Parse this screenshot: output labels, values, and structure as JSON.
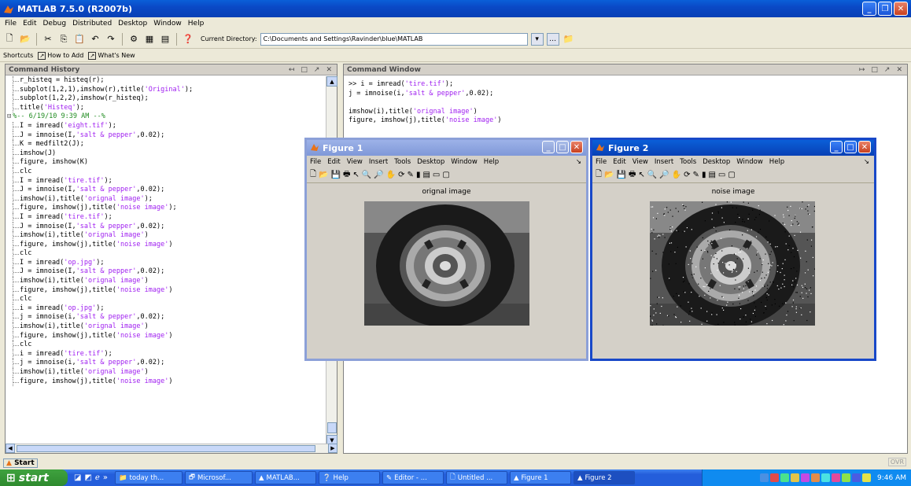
{
  "app": {
    "title": "MATLAB 7.5.0 (R2007b)",
    "menu": [
      "File",
      "Edit",
      "Debug",
      "Distributed",
      "Desktop",
      "Window",
      "Help"
    ]
  },
  "toolbar": {
    "current_directory_label": "Current Directory:",
    "current_directory_value": "C:\\Documents and Settings\\Ravinder\\blue\\MATLAB"
  },
  "shortcuts": {
    "label": "Shortcuts",
    "items": [
      "How to Add",
      "What's New"
    ]
  },
  "history": {
    "title": "Command History",
    "lines": [
      {
        "code": "r_histeq = histeq(r);"
      },
      {
        "code": "subplot(1,2,1),imshow(r),title(",
        "str": "'Original'",
        "tail": ");"
      },
      {
        "code": "subplot(1,2,2),imshow(r_histeq);"
      },
      {
        "code": "title(",
        "str": "'Histeq'",
        "tail": ");"
      },
      {
        "node": "%-- 6/19/10  9:39 AM --%"
      },
      {
        "code": "I = imread(",
        "str": "'eight.tif'",
        "tail": ");"
      },
      {
        "code": "J = imnoise(I,",
        "str": "'salt & pepper'",
        "tail": ",0.02);"
      },
      {
        "code": "K = medfilt2(J);"
      },
      {
        "code": "imshow(J)"
      },
      {
        "code": "figure, imshow(K)"
      },
      {
        "code": "clc"
      },
      {
        "code": "I = imread(",
        "str": "'tire.tif'",
        "tail": ");"
      },
      {
        "code": "J = imnoise(I,",
        "str": "'salt & pepper'",
        "tail": ",0.02);"
      },
      {
        "code": "imshow(i),title(",
        "str": "'orignal image'",
        "tail": ");"
      },
      {
        "code": "figure, imshow(j),title(",
        "str": "'noise image'",
        "tail": ");"
      },
      {
        "code": "I = imread(",
        "str": "'tire.tif'",
        "tail": ");"
      },
      {
        "code": "J = imnoise(I,",
        "str": "'salt & pepper'",
        "tail": ",0.02);"
      },
      {
        "code": "imshow(i),title(",
        "str": "'orignal image'",
        "tail": ")"
      },
      {
        "code": "figure, imshow(j),title(",
        "str": "'noise image'",
        "tail": ")"
      },
      {
        "code": "clc"
      },
      {
        "code": "I = imread(",
        "str": "'op.jpg'",
        "tail": ");"
      },
      {
        "code": "J = imnoise(I,",
        "str": "'salt & pepper'",
        "tail": ",0.02);"
      },
      {
        "code": "imshow(i),title(",
        "str": "'orignal image'",
        "tail": ")"
      },
      {
        "code": "figure, imshow(j),title(",
        "str": "'noise image'",
        "tail": ")"
      },
      {
        "code": "clc"
      },
      {
        "code": "i = imread(",
        "str": "'op.jpg'",
        "tail": ");"
      },
      {
        "code": "j = imnoise(i,",
        "str": "'salt & pepper'",
        "tail": ",0.02);"
      },
      {
        "code": "imshow(i),title(",
        "str": "'orignal image'",
        "tail": ")"
      },
      {
        "code": "figure, imshow(j),title(",
        "str": "'noise image'",
        "tail": ")"
      },
      {
        "code": "clc"
      },
      {
        "code": "i = imread(",
        "str": "'tire.tif'",
        "tail": ");"
      },
      {
        "code": "j = imnoise(i,",
        "str": "'salt & pepper'",
        "tail": ",0.02);"
      },
      {
        "code": "imshow(i),title(",
        "str": "'orignal image'",
        "tail": ")"
      },
      {
        "code": "figure, imshow(j),title(",
        "str": "'noise image'",
        "tail": ")"
      }
    ]
  },
  "command_window": {
    "title": "Command Window",
    "lines": [
      {
        "code": ">> i = imread(",
        "str": "'tire.tif'",
        "tail": ");"
      },
      {
        "code": "j = imnoise(i,",
        "str": "'salt & pepper'",
        "tail": ",0.02);"
      },
      {
        "code": ""
      },
      {
        "code": "imshow(i),title(",
        "str": "'orignal image'",
        "tail": ")"
      },
      {
        "code": "figure, imshow(j),title(",
        "str": "'noise image'",
        "tail": ")"
      }
    ]
  },
  "figures": [
    {
      "title": "Figure 1",
      "caption": "orignal image"
    },
    {
      "title": "Figure 2",
      "caption": "noise image"
    }
  ],
  "figure_menu": [
    "File",
    "Edit",
    "View",
    "Insert",
    "Tools",
    "Desktop",
    "Window",
    "Help"
  ],
  "status": {
    "start_label": "Start",
    "ovr": "OVR"
  },
  "taskbar": {
    "start": "start",
    "tasks": [
      "today th...",
      "Microsof...",
      "MATLAB...",
      "Help",
      "Editor - ...",
      "Untitled ...",
      "Figure 1",
      "Figure 2"
    ],
    "active_task": "Figure 2",
    "clock": "9:46 AM"
  },
  "colors": {
    "string": "#a020f0",
    "accent": "#0a49c6",
    "taskbar": "#245edb"
  }
}
